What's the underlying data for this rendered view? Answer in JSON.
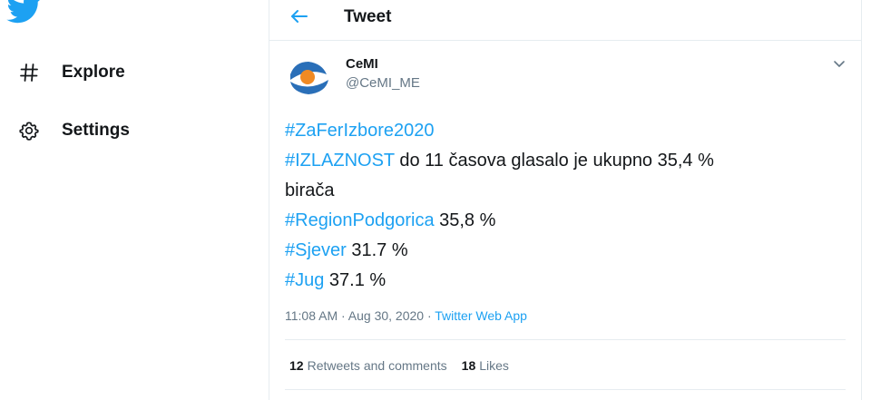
{
  "colors": {
    "accent": "#1da1f2",
    "text": "#14171a",
    "muted": "#657786",
    "divider": "#e6ecf0"
  },
  "sidebar": {
    "logo_icon": "twitter-bird-icon",
    "items": [
      {
        "icon": "hashtag-icon",
        "label": "Explore"
      },
      {
        "icon": "gear-icon",
        "label": "Settings"
      }
    ]
  },
  "header": {
    "back_icon": "arrow-left-icon",
    "title": "Tweet"
  },
  "tweet": {
    "author": {
      "name": "CeMI",
      "handle": "@CeMI_ME"
    },
    "menu_icon": "chevron-down-icon",
    "lines": {
      "l1_tag": "#ZaFerIzbore2020",
      "l2_tag": "#IZLAZNOST",
      "l2_text": " do 11 časova glasalo je ukupno 35,4 %",
      "l3_text": "birača",
      "l4_tag": "#RegionPodgorica",
      "l4_text": " 35,8 %",
      "l5_tag": "#Sjever",
      "l5_text": " 31.7 %",
      "l6_tag": "#Jug",
      "l6_text": " 37.1 %"
    },
    "timestamp": "11:08 AM · Aug 30, 2020 · ",
    "source": "Twitter Web App",
    "stats": {
      "retweets_count": "12",
      "retweets_label": "Retweets and comments",
      "likes_count": "18",
      "likes_label": "Likes"
    }
  }
}
